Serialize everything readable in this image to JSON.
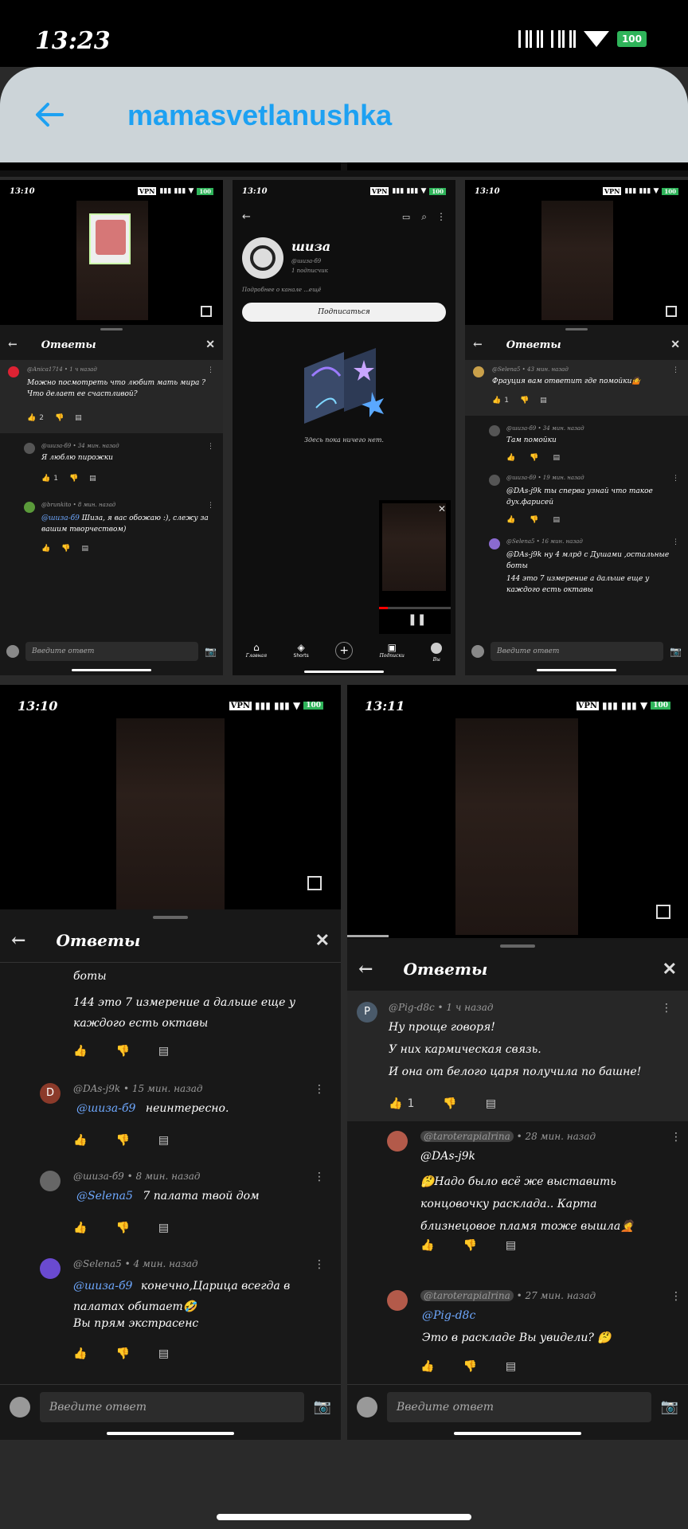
{
  "status_bar": {
    "time": "13:23",
    "battery": "100"
  },
  "app_bar": {
    "title": "mamasvetlanushka"
  },
  "panel_a": {
    "time": "13:10",
    "header": "Ответы",
    "top_comment": {
      "author": "@Anica1714 • 1 ч назад",
      "text": "Можно посмотреть что любит мать мира ? Что делает ее счастливой?",
      "likes": "2"
    },
    "replies": [
      {
        "author": "@шиза-б9 • 34 мин. назад",
        "text": "Я люблю пирожки",
        "likes": "1"
      },
      {
        "author": "@brunkito • 8 мин. назад",
        "mention": "@шиза-б9",
        "text": "Шиза, я вас обожаю :), слежу за вашим творчеством)"
      }
    ],
    "reply_placeholder": "Введите ответ"
  },
  "panel_b": {
    "time": "13:10",
    "channel_name": "шиза",
    "handle": "@шиза-б9",
    "subs": "1 подписчик",
    "about": "Подробнее о канале ...ещё",
    "subscribe": "Подписаться",
    "empty": "Здесь пока ничего нет.",
    "nav": [
      "Главная",
      "Shorts",
      "",
      "Подписки",
      "Вы"
    ]
  },
  "panel_c": {
    "time": "13:10",
    "header": "Ответы",
    "top_comment": {
      "author": "@Selena5 • 43 мин. назад",
      "text": "Фрауция вам ответит где помойки🤷",
      "likes": "1"
    },
    "replies": [
      {
        "author": "@шиза-б9 • 34 мин. назад",
        "text": "Там помойки"
      },
      {
        "author": "@шиза-б9 • 19 мин. назад",
        "text": "@DAs-j9k ты сперва узнай что такое дух.фарисей"
      },
      {
        "author": "@Selena5 • 16 мин. назад",
        "text": "@DAs-j9k ну 4 млрд с Душами ,остальные боты",
        "text2": "144 это 7 измерение а дальше еще у каждого есть октавы"
      }
    ],
    "reply_placeholder": "Введите ответ"
  },
  "panel_d": {
    "time": "13:10",
    "header": "Ответы",
    "top_lines": [
      "боты",
      "144 это 7 измерение а дальше еще у каждого есть октавы"
    ],
    "replies": [
      {
        "author": "@DAs-j9k • 15 мин. назад",
        "mention": "@шиза-б9",
        "text": "неинтересно.",
        "initial": "D"
      },
      {
        "author": "@шиза-б9 • 8 мин. назад",
        "mention": "@Selena5",
        "text": "7 палата твой дом"
      },
      {
        "author": "@Selena5 • 4 мин. назад",
        "mention": "@шиза-б9",
        "text": "конечно,Царица всегда в палатах обитает🤣",
        "text2": "Вы прям экстрасенс"
      }
    ],
    "reply_placeholder": "Введите ответ"
  },
  "panel_e": {
    "time": "13:11",
    "header": "Ответы",
    "top_comment": {
      "initial": "P",
      "author": "@Pig-d8c • 1 ч назад",
      "lines": [
        "Ну проще говоря!",
        "У них кармическая связь.",
        "И она от белого царя получила по башне!"
      ],
      "likes": "1"
    },
    "replies": [
      {
        "author_chip": "@taroterapialrina",
        "time": "• 28 мин. назад",
        "mention": "@DAs-j9k",
        "text": "🤔Надо было всё же выставить концовочку расклада.. Карта близнецовое пламя тоже вышла🤦"
      },
      {
        "author_chip": "@taroterapialrina",
        "time": "• 27 мин. назад",
        "mention": "@Pig-d8c",
        "text": "Это в раскладе Вы увидели? 🤔"
      }
    ],
    "reply_placeholder": "Введите ответ"
  },
  "colors": {
    "accent": "#1da1f2",
    "mention": "#6ea8ff",
    "battery": "#2fb45a"
  }
}
